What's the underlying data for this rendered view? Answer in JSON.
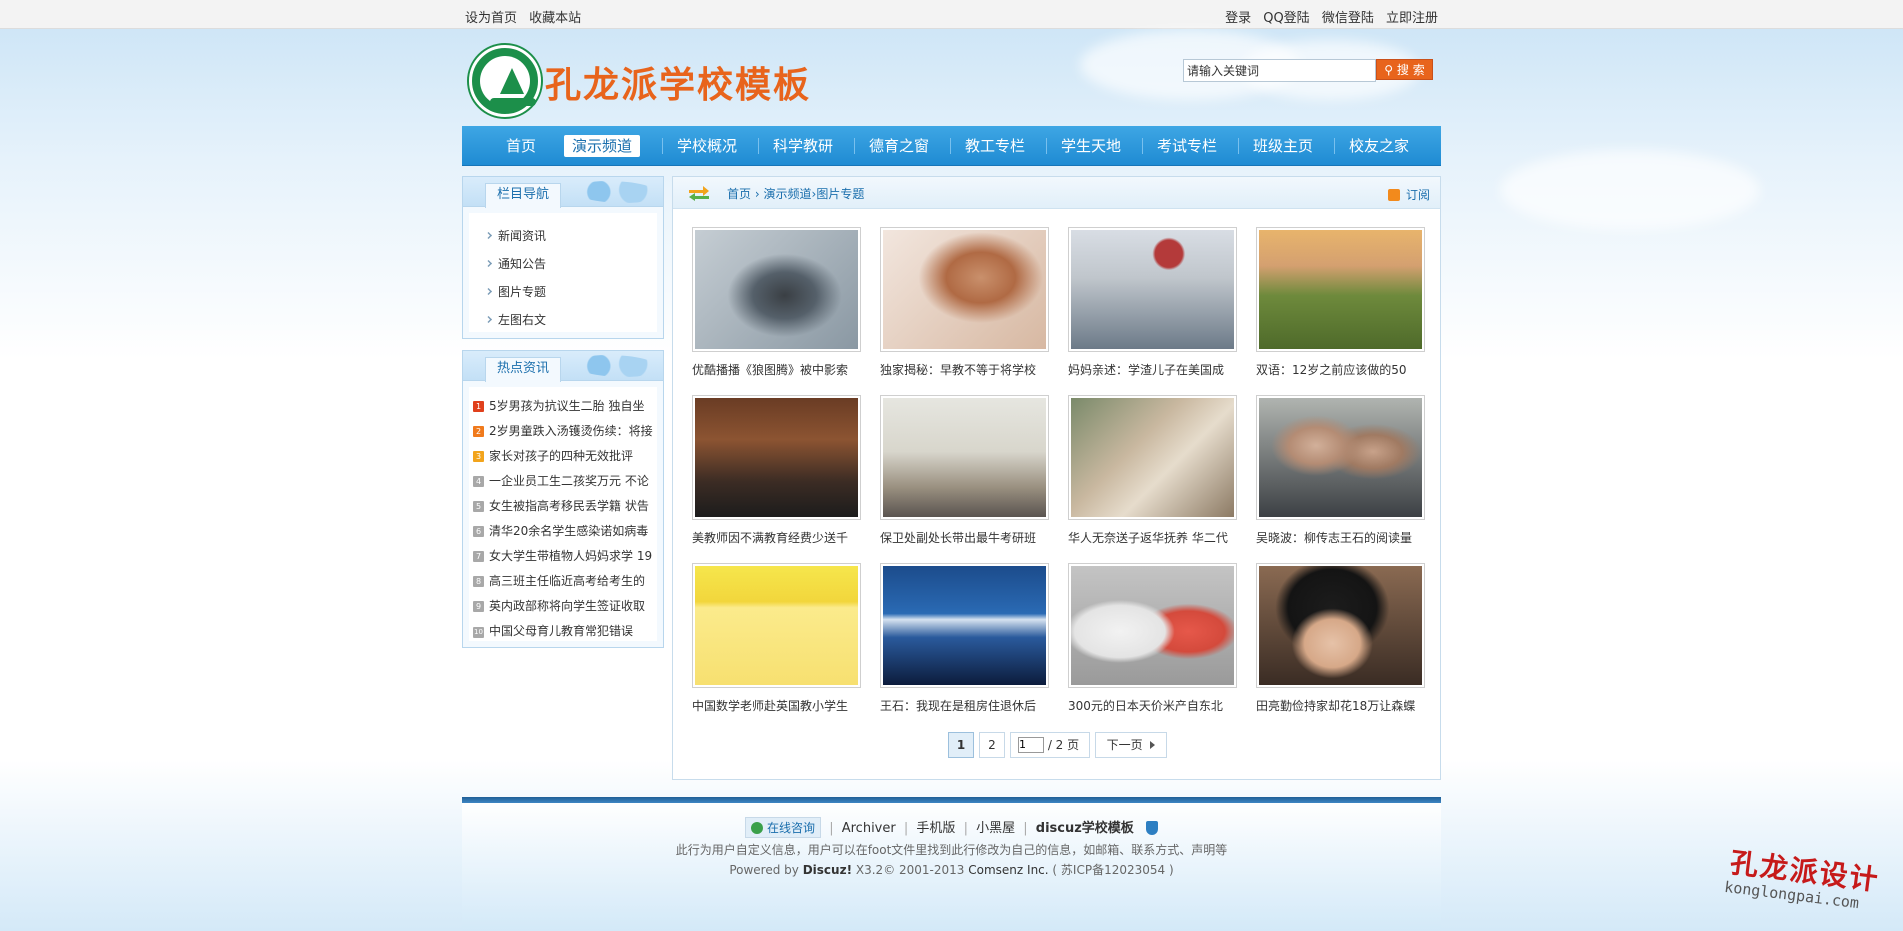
{
  "topbar": {
    "set_home": "设为首页",
    "bookmark": "收藏本站",
    "login": "登录",
    "qq_login": "QQ登陆",
    "wechat_login": "微信登陆",
    "register": "立即注册"
  },
  "header": {
    "site_title": "孔龙派学校模板",
    "search_placeholder": "请输入关键词",
    "search_button": "搜 索"
  },
  "nav": {
    "items": [
      "首页",
      "演示频道",
      "学校概况",
      "科学教研",
      "德育之窗",
      "教工专栏",
      "学生天地",
      "考试专栏",
      "班级主页",
      "校友之家"
    ],
    "active_index": 1
  },
  "sidebar": {
    "cat_title": "栏目导航",
    "categories": [
      "新闻资讯",
      "通知公告",
      "图片专题",
      "左图右文"
    ],
    "hot_title": "热点资讯",
    "hot": [
      {
        "num": "1",
        "text": "5岁男孩为抗议生二胎 独自坐"
      },
      {
        "num": "2",
        "text": "2岁男童跌入汤镬烫伤续：将接"
      },
      {
        "num": "3",
        "text": "家长对孩子的四种无效批评"
      },
      {
        "num": "4",
        "text": "一企业员工生二孩奖万元 不论"
      },
      {
        "num": "5",
        "text": "女生被指高考移民丢学籍 状告"
      },
      {
        "num": "6",
        "text": "清华20余名学生感染诺如病毒"
      },
      {
        "num": "7",
        "text": "女大学生带植物人妈妈求学 19"
      },
      {
        "num": "8",
        "text": "高三班主任临近高考给考生的"
      },
      {
        "num": "9",
        "text": "英内政部称将向学生签证收取"
      },
      {
        "num": "10",
        "text": "中国父母育儿教育常犯错误"
      }
    ]
  },
  "main": {
    "crumb_home": "首页",
    "crumb_sep1": "›",
    "crumb_channel": "演示频道",
    "crumb_sep2": "›",
    "crumb_current": "图片专题",
    "subscribe": "订阅",
    "photos": [
      "优酷播播《狼图腾》被中影索",
      "独家揭秘：早教不等于将学校",
      "妈妈亲述：学渣儿子在美国成",
      "双语：12岁之前应该做的50",
      "美教师因不满教育经费少送千",
      "保卫处副处长带出最牛考研班",
      "华人无奈送子返华抚养 华二代",
      "吴晓波：柳传志王石的阅读量",
      "中国数学老师赴英国教小学生",
      "王石：我现在是租房住退休后",
      "300元的日本天价米产自东北",
      "田亮勤俭持家却花18万让森蝶"
    ],
    "pager": {
      "page1": "1",
      "page2": "2",
      "page_input": "1",
      "total": "/ 2 页",
      "next": "下一页"
    }
  },
  "footer": {
    "consult": "在线咨询",
    "archiver": "Archiver",
    "mobile": "手机版",
    "blackroom": "小黑屋",
    "template": "discuz学校模板",
    "info": "此行为用户自定义信息，用户可以在foot文件里找到此行修改为自己的信息，如邮箱、联系方式、声明等",
    "powered": "Powered by",
    "discuz": "Discuz!",
    "version": "X3.2",
    "copyright": "© 2001-2013",
    "company": "Comsenz Inc.",
    "icp": "( 苏ICP备12023054 )"
  },
  "watermark": {
    "cn": "孔龙派设计",
    "en": "konglongpai.com"
  }
}
